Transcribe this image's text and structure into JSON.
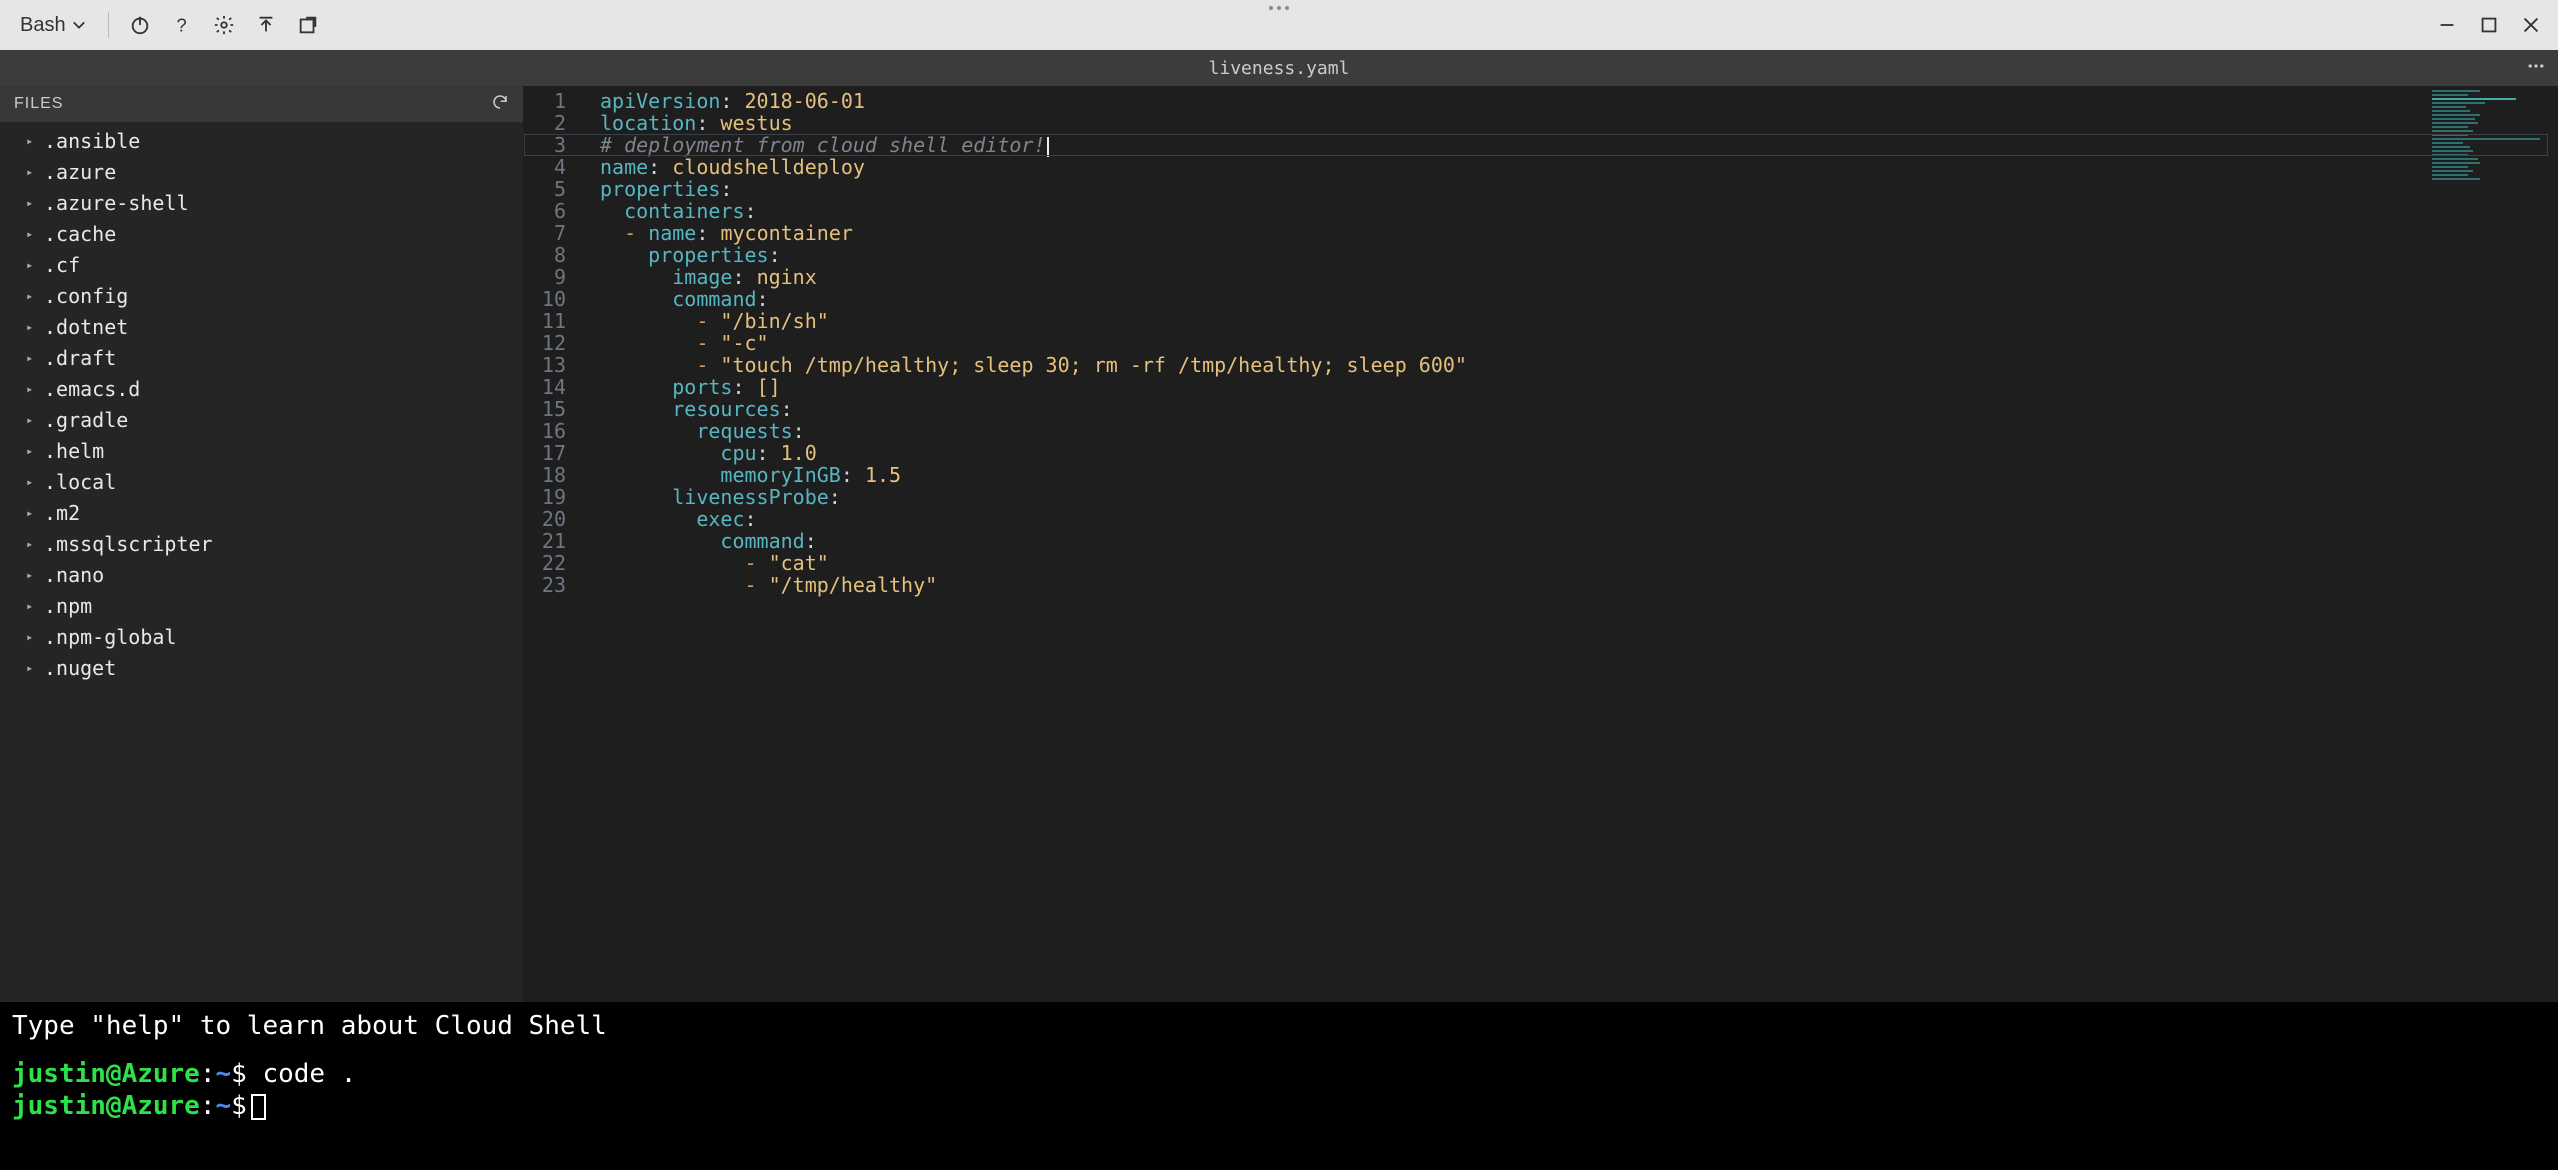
{
  "toolbar": {
    "shell_label": "Bash"
  },
  "editor": {
    "filename": "liveness.yaml",
    "sidebar_title": "FILES",
    "files": [
      ".ansible",
      ".azure",
      ".azure-shell",
      ".cache",
      ".cf",
      ".config",
      ".dotnet",
      ".draft",
      ".emacs.d",
      ".gradle",
      ".helm",
      ".local",
      ".m2",
      ".mssqlscripter",
      ".nano",
      ".npm",
      ".npm-global",
      ".nuget"
    ],
    "line_start": 1,
    "line_end": 23,
    "code": [
      {
        "n": 1,
        "t": "kv",
        "k": "apiVersion",
        "v": "2018-06-01",
        "i": 0
      },
      {
        "n": 2,
        "t": "kv",
        "k": "location",
        "v": "westus",
        "i": 0
      },
      {
        "n": 3,
        "t": "comment",
        "text": "# deployment from cloud shell editor!",
        "i": 0,
        "cursor": true,
        "hl": true
      },
      {
        "n": 4,
        "t": "kv",
        "k": "name",
        "v": "cloudshelldeploy",
        "i": 0
      },
      {
        "n": 5,
        "t": "k",
        "k": "properties",
        "i": 0
      },
      {
        "n": 6,
        "t": "k",
        "k": "containers",
        "i": 1
      },
      {
        "n": 7,
        "t": "dkv",
        "k": "name",
        "v": "mycontainer",
        "i": 1
      },
      {
        "n": 8,
        "t": "k",
        "k": "properties",
        "i": 2
      },
      {
        "n": 9,
        "t": "kv",
        "k": "image",
        "v": "nginx",
        "i": 3
      },
      {
        "n": 10,
        "t": "k",
        "k": "command",
        "i": 3
      },
      {
        "n": 11,
        "t": "ds",
        "v": "\"/bin/sh\"",
        "i": 4
      },
      {
        "n": 12,
        "t": "ds",
        "v": "\"-c\"",
        "i": 4
      },
      {
        "n": 13,
        "t": "ds",
        "v": "\"touch /tmp/healthy; sleep 30; rm -rf /tmp/healthy; sleep 600\"",
        "i": 4
      },
      {
        "n": 14,
        "t": "kv",
        "k": "ports",
        "v": "[]",
        "i": 3
      },
      {
        "n": 15,
        "t": "k",
        "k": "resources",
        "i": 3
      },
      {
        "n": 16,
        "t": "k",
        "k": "requests",
        "i": 4
      },
      {
        "n": 17,
        "t": "kv",
        "k": "cpu",
        "v": "1.0",
        "i": 5
      },
      {
        "n": 18,
        "t": "kv",
        "k": "memoryInGB",
        "v": "1.5",
        "i": 5
      },
      {
        "n": 19,
        "t": "k",
        "k": "livenessProbe",
        "i": 3
      },
      {
        "n": 20,
        "t": "k",
        "k": "exec",
        "i": 4
      },
      {
        "n": 21,
        "t": "k",
        "k": "command",
        "i": 5
      },
      {
        "n": 22,
        "t": "ds",
        "v": "\"cat\"",
        "i": 6
      },
      {
        "n": 23,
        "t": "ds",
        "v": "\"/tmp/healthy\"",
        "i": 6
      }
    ]
  },
  "terminal": {
    "hint": "Type \"help\" to learn about Cloud Shell",
    "user": "justin",
    "host": "Azure",
    "cwd": "~",
    "lines": [
      {
        "cmd": "code ."
      },
      {
        "cmd": ""
      }
    ]
  }
}
